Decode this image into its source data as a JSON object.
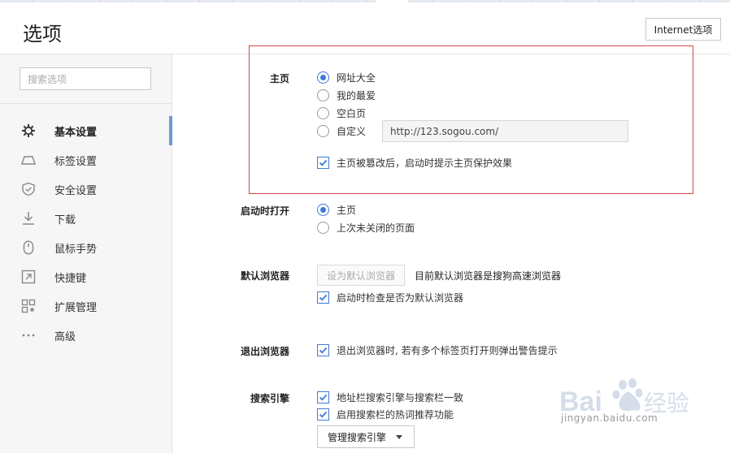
{
  "window": {
    "title": "选项"
  },
  "header": {
    "internet_options_label": "Internet选项"
  },
  "sidebar": {
    "search_placeholder": "搜索选项",
    "items": [
      {
        "label": "基本设置",
        "icon": "gear-icon",
        "active": true
      },
      {
        "label": "标签设置",
        "icon": "tab-icon"
      },
      {
        "label": "安全设置",
        "icon": "shield-icon"
      },
      {
        "label": "下载",
        "icon": "download-icon"
      },
      {
        "label": "鼠标手势",
        "icon": "mouse-icon"
      },
      {
        "label": "快捷键",
        "icon": "shortcut-icon"
      },
      {
        "label": "扩展管理",
        "icon": "extensions-icon"
      },
      {
        "label": "高级",
        "icon": "more-icon"
      }
    ]
  },
  "homepage": {
    "label": "主页",
    "options": [
      "网址大全",
      "我的最爱",
      "空白页",
      "自定义"
    ],
    "selected": "网址大全",
    "custom_url": "http://123.sogou.com/",
    "protect_label": "主页被篡改后，启动时提示主页保护效果",
    "protect_checked": true
  },
  "startup": {
    "label": "启动时打开",
    "options": [
      "主页",
      "上次未关闭的页面"
    ],
    "selected": "主页"
  },
  "default_browser": {
    "label": "默认浏览器",
    "button_label": "设为默认浏览器",
    "status": "目前默认浏览器是搜狗高速浏览器",
    "check_label": "启动时检查是否为默认浏览器",
    "check_checked": true
  },
  "exit": {
    "label": "退出浏览器",
    "check_label": "退出浏览器时, 若有多个标签页打开则弹出警告提示",
    "check_checked": true
  },
  "search_engine": {
    "label": "搜索引擎",
    "checks": [
      {
        "label": "地址栏搜索引擎与搜索栏一致",
        "checked": true
      },
      {
        "label": "启用搜索栏的热词推荐功能",
        "checked": true
      }
    ],
    "manage_label": "管理搜索引擎"
  },
  "watermark": {
    "brand": "Baidu经验",
    "url": "jingyan.baidu.com"
  },
  "colors": {
    "accent": "#3d7ad6",
    "highlight_border": "#d24a4a",
    "sidebar_bg": "#f6f6f6"
  }
}
